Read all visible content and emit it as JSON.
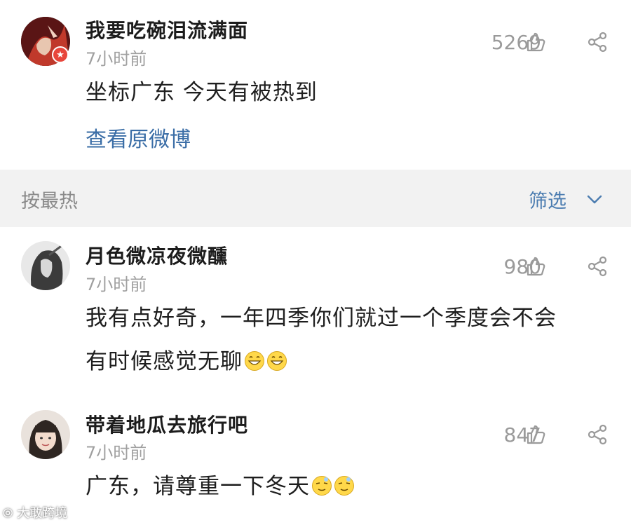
{
  "post": {
    "username": "我要吃碗泪流满面",
    "time": "7小时前",
    "likes": "5269",
    "text": "坐标广东 今天有被热到",
    "view_original": "查看原微博"
  },
  "sort_bar": {
    "sort_label": "按最热",
    "filter_label": "筛选"
  },
  "comments": [
    {
      "username": "月色微凉夜微醺",
      "time": "7小时前",
      "likes": "980",
      "text_line1": "我有点好奇，一年四季你们就过一个季度会不会",
      "text_line2": "有时候感觉无聊",
      "emojis": [
        "grin-emoji",
        "grin-emoji"
      ]
    },
    {
      "username": "带着地瓜去旅行吧",
      "time": "7小时前",
      "likes": "847",
      "text_line1": "广东，请尊重一下冬天",
      "emojis": [
        "dizzy-emoji",
        "dizzy-emoji"
      ]
    }
  ],
  "watermark": "大敢跨境",
  "colors": {
    "link": "#3a6da6",
    "filter": "#4b7cb0",
    "separator_bg": "#f2f2f2",
    "badge": "#e8463b",
    "muted": "#a0a0a0"
  }
}
